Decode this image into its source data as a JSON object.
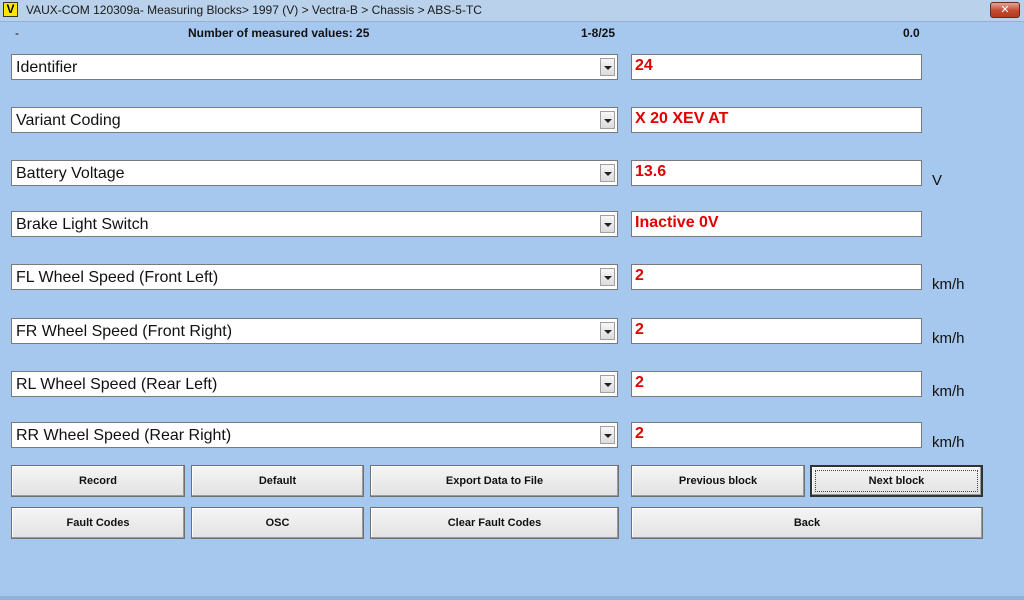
{
  "window": {
    "app_icon_letter": "V",
    "title": "VAUX-COM 120309a- Measuring Blocks> 1997 (V) > Vectra-B > Chassis > ABS-5-TC",
    "close_glyph": "✕"
  },
  "info": {
    "dash": "-",
    "count_text": "Number of measured values: 25",
    "range_text": "1-8/25",
    "value_text": "0.0"
  },
  "rows": [
    {
      "label": "Identifier",
      "value": "24",
      "unit": ""
    },
    {
      "label": "Variant Coding",
      "value": "X 20 XEV AT",
      "unit": ""
    },
    {
      "label": "Battery Voltage",
      "value": "13.6",
      "unit": "V"
    },
    {
      "label": "Brake Light Switch",
      "value": "Inactive 0V",
      "unit": ""
    },
    {
      "label": "FL Wheel Speed (Front Left)",
      "value": "2",
      "unit": "km/h"
    },
    {
      "label": "FR Wheel Speed (Front Right)",
      "value": "2",
      "unit": "km/h"
    },
    {
      "label": "RL Wheel Speed (Rear Left)",
      "value": "2",
      "unit": "km/h"
    },
    {
      "label": "RR Wheel Speed (Rear Right)",
      "value": "2",
      "unit": "km/h"
    }
  ],
  "buttons": {
    "record": "Record",
    "default": "Default",
    "export": "Export Data to File",
    "previous": "Previous block",
    "next": "Next block",
    "fault_codes": "Fault Codes",
    "osc": "OSC",
    "clear_fault_codes": "Clear Fault Codes",
    "back": "Back"
  },
  "colors": {
    "background": "#a6c8ee",
    "value_text": "#e00000"
  }
}
